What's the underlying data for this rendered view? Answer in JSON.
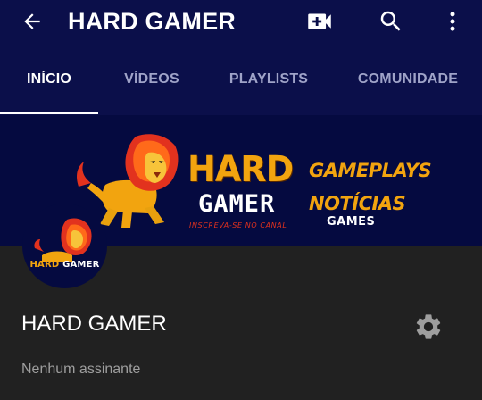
{
  "appbar": {
    "title": "HARD GAMER",
    "icons": [
      "back-arrow-icon",
      "video-add-icon",
      "search-icon",
      "more-vert-icon"
    ]
  },
  "tabs": [
    {
      "label": "INÍCIO",
      "active": true
    },
    {
      "label": "VÍDEOS",
      "active": false
    },
    {
      "label": "PLAYLISTS",
      "active": false
    },
    {
      "label": "COMUNIDADE",
      "active": false
    }
  ],
  "banner": {
    "hard": "HARD",
    "gamer": "GAMER",
    "tagline": "INSCREVA-SE NO CANAL",
    "gameplays": "GAMEPLAYS",
    "noticias": "NOTÍCIAS",
    "games": "GAMES"
  },
  "avatar": {
    "hard": "HARD",
    "gamer": "GAMER"
  },
  "channel": {
    "name": "HARD GAMER",
    "subscribers": "Nenhum assinante"
  },
  "colors": {
    "header_bg": "#0b0f4a",
    "page_bg": "#212121",
    "accent_orange": "#f2a40f",
    "tab_inactive": "#9fa3c8"
  }
}
